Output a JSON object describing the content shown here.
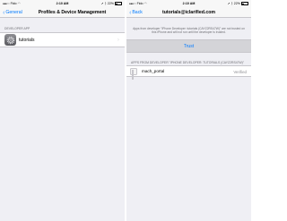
{
  "left_screen": {
    "status": {
      "carrier": "Fido",
      "time": "2:10 AM",
      "battery": "22%"
    },
    "nav": {
      "back_label": "General",
      "title": "Profiles & Device Management"
    },
    "section_header": "DEVELOPER APP",
    "app_item": {
      "label": "tutorials",
      "icon": "app-gear-icon"
    }
  },
  "right_screen": {
    "status": {
      "carrier": "Fido",
      "time": "2:10 AM",
      "battery": "22%"
    },
    "nav": {
      "back_label": "Back",
      "title": "tutorials@iclarified.com"
    },
    "trust_message": "Apps from developer \"iPhone Developer: tutorials (CAYZ2RS47W)\" are not trusted on this iPhone and will not run until the developer is trusted.",
    "trust_button": "Trust",
    "section_header": "APPS FROM DEVELOPER \"IPHONE DEVELOPER: TUTORIALS (CAYZ2RS47W)\"",
    "app_item": {
      "label": "mach_portal",
      "status": "Verified"
    }
  },
  "colors": {
    "accent": "#007aff",
    "background": "#efeff4"
  }
}
